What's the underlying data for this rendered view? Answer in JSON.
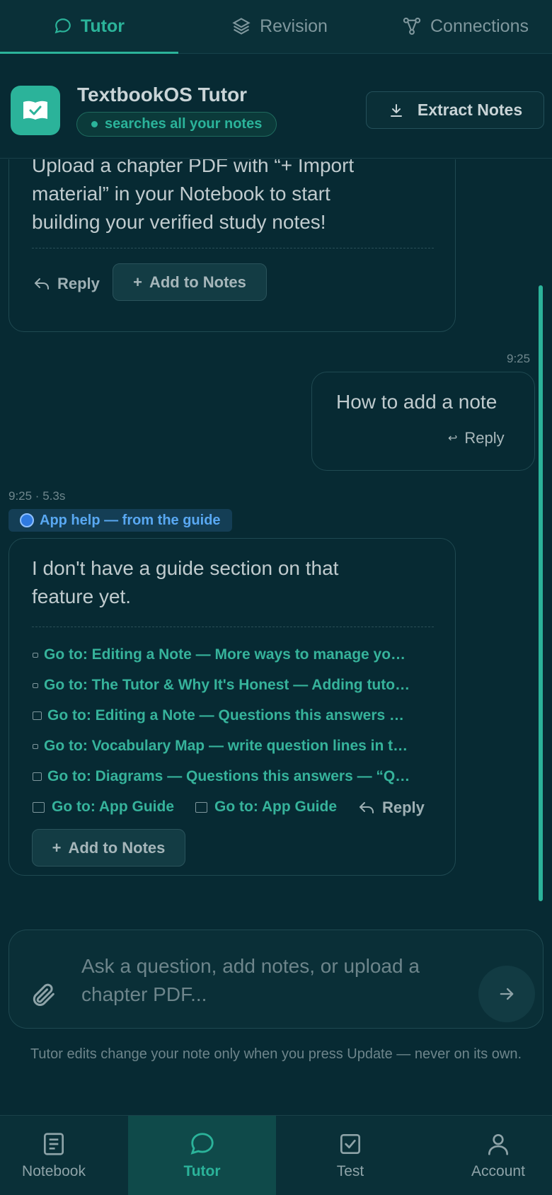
{
  "tabs": [
    {
      "label": "Tutor",
      "icon": "chat-bubble-icon",
      "active": true
    },
    {
      "label": "Revision",
      "icon": "layers-icon",
      "active": false
    },
    {
      "label": "Connections",
      "icon": "graph-nodes-icon",
      "active": false
    }
  ],
  "header": {
    "title": "TextbookOS Tutor",
    "status_pill": "searches all your notes",
    "extract_button": "Extract Notes"
  },
  "messages": {
    "first": {
      "partial_line": "Upload a chapter PDF with “+ Import",
      "text": "material” in your Notebook to start building your verified study notes!",
      "reply_label": "Reply",
      "add_label": "Add to Notes"
    },
    "user": {
      "time": "9:25",
      "text": "How to add a note",
      "reply_label": "Reply"
    },
    "answer": {
      "meta": "9:25 · 5.3s",
      "badge": "App help — from the guide",
      "text": "I don't have a guide section on that feature yet.",
      "links": [
        "Go to: Editing a Note — More ways to manage yo…",
        "Go to: The Tutor & Why It's Honest — Adding tuto…",
        "Go to: Editing a Note — Questions this answers …",
        "Go to: Vocabulary Map — write question lines in t…",
        "Go to: Diagrams — Questions this answers — “Q…"
      ],
      "guide_link_1": "Go to: App Guide",
      "guide_link_2": "Go to: App Guide",
      "reply_label": "Reply",
      "add_label": "Add to Notes"
    }
  },
  "composer": {
    "placeholder": "Ask a question, add notes, or upload a chapter PDF..."
  },
  "disclaimer": "Tutor edits change your note only when you press Update — never on its own.",
  "bottom_nav": [
    {
      "label": "Notebook",
      "icon": "notebook-icon",
      "active": false
    },
    {
      "label": "Tutor",
      "icon": "chat-bubble-icon",
      "active": true
    },
    {
      "label": "Test",
      "icon": "checkbox-icon",
      "active": false
    },
    {
      "label": "Account",
      "icon": "person-icon",
      "active": false
    }
  ],
  "colors": {
    "accent": "#2bb39a",
    "background": "#072a33",
    "help_badge": "#59a8f2"
  }
}
